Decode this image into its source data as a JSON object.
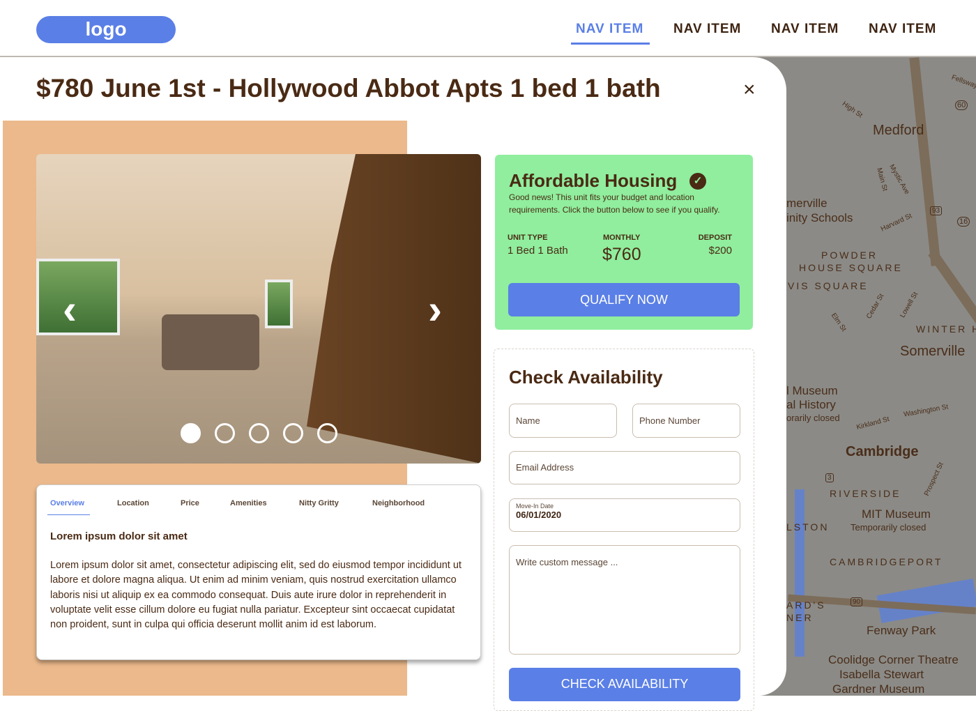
{
  "header": {
    "logo": "logo",
    "nav": [
      "NAV ITEM",
      "NAV ITEM",
      "NAV ITEM",
      "NAV ITEM"
    ]
  },
  "listing": {
    "title": "$780 June 1st - Hollywood Abbot Apts 1 bed 1 bath",
    "close": "×"
  },
  "carousel": {
    "prev": "‹",
    "next": "›",
    "slides": 5,
    "active": 1
  },
  "tabs": {
    "items": [
      "Overview",
      "Location",
      "Price",
      "Amenities",
      "Nitty Gritty",
      "Neighborhood"
    ],
    "heading": "Lorem ipsum dolor sit amet",
    "body": "Lorem ipsum dolor sit amet, consectetur adipiscing elit, sed do eiusmod tempor incididunt ut labore et dolore magna aliqua. Ut enim ad minim veniam, quis nostrud exercitation ullamco laboris nisi ut aliquip ex ea commodo consequat. Duis aute irure dolor in reprehenderit in voluptate velit esse cillum dolore eu fugiat nulla pariatur. Excepteur sint occaecat cupidatat non proident, sunt in culpa qui officia deserunt mollit anim id est laborum."
  },
  "affordable": {
    "title": "Affordable Housing",
    "check": "✓",
    "desc": "Good news! This unit fits your budget and location requirements. Click the button below to see if you qualify.",
    "unit_type_label": "UNIT TYPE",
    "unit_type": "1 Bed 1 Bath",
    "monthly_label": "MONTHLY",
    "monthly": "$760",
    "deposit_label": "DEPOSIT",
    "deposit": "$200",
    "button": "QUALIFY NOW"
  },
  "availability": {
    "title": "Check Availability",
    "name": "Name",
    "phone": "Phone Number",
    "email": "Email Address",
    "move_in_label": "Move-In Date",
    "move_in": "06/01/2020",
    "message": "Write custom message ...",
    "button": "CHECK AVAILABILITY"
  },
  "map": {
    "labels": [
      "Medford",
      "merville",
      "inity Schools",
      "POWDER",
      "HOUSE SQUARE",
      "VIS SQUARE",
      "WINTER H",
      "Somerville",
      "l Museum",
      "al History",
      "orarily closed",
      "Cambridge",
      "RIVERSIDE",
      "MIT Museum",
      "Temporarily closed",
      "LSTON",
      "CAMBRIDGEPORT",
      "ARD'S",
      "NER",
      "Fenway Park",
      "Coolidge Corner Theatre",
      "Isabella Stewart",
      "Gardner Museum",
      "High St",
      "Harvard St",
      "Main St",
      "Mystic Ave",
      "Elm St",
      "Cedar St",
      "Lowell St",
      "Kirkland St",
      "Washington St",
      "Prospect St",
      "Fellsway",
      "60",
      "16",
      "93",
      "3",
      "90"
    ]
  }
}
